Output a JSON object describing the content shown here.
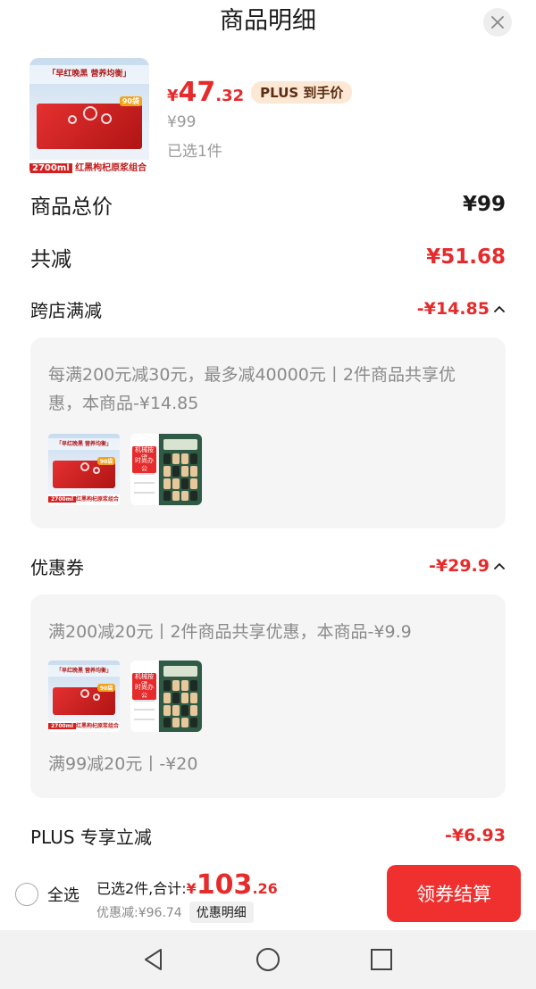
{
  "header": {
    "title": "商品明细"
  },
  "product": {
    "thumb": {
      "slogan": "「早红晚黑  营养均衡」",
      "badge": "90袋",
      "volume": "2700ml",
      "caption": "红黑枸杞原浆组合"
    },
    "price": {
      "currency": "¥",
      "integer": "47",
      "decimal": ".32"
    },
    "plus_tag": "PLUS 到手价",
    "original_price": "¥99",
    "selected": "已选1件"
  },
  "summary": {
    "total_label": "商品总价",
    "total_value": "¥99",
    "reduce_label": "共减",
    "reduce_value": "¥51.68"
  },
  "cross_store": {
    "label": "跨店满减",
    "value": "-¥14.85",
    "desc": "每满200元减30元，最多减40000元丨2件商品共享优惠，本商品-¥14.85",
    "calc_tags": [
      "机械按键",
      "时尚办公"
    ]
  },
  "coupon": {
    "label": "优惠券",
    "value": "-¥29.9",
    "desc": "满200减20元丨2件商品共享优惠，本商品-¥9.9",
    "desc2": "满99减20元丨-¥20",
    "calc_tags": [
      "机械按键",
      "时尚办公"
    ]
  },
  "plus_discount": {
    "label": "PLUS 专享立减",
    "value": "-¥6.93"
  },
  "bottom_bar": {
    "select_all": "全选",
    "total_label": "已选2件,合计:",
    "total_currency": "¥",
    "total_integer": "103",
    "total_decimal": ".26",
    "discount_label": "优惠减:¥96.74",
    "detail_button": "优惠明细",
    "checkout_button": "领券结算"
  },
  "colors": {
    "accent": "#e52b2b",
    "checkout": "#f0302e",
    "plus_tag_bg": "#fde7d5"
  },
  "icons": [
    "close-icon",
    "chevron-up-icon",
    "radio-icon",
    "back-icon",
    "home-icon",
    "recents-icon"
  ]
}
